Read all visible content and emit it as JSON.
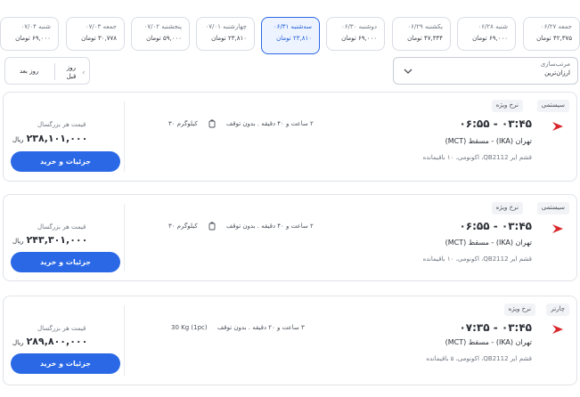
{
  "days": [
    {
      "day": "جمعه ۰۶/۲۷",
      "price": "۴۲,۳۷۵ تومان",
      "active": false
    },
    {
      "day": "شنبه ۰۶/۲۸",
      "price": "۶۹,۰۰۰ تومان",
      "active": false
    },
    {
      "day": "یکشنبه ۰۶/۲۹",
      "price": "۴۷,۳۳۴ تومان",
      "active": false
    },
    {
      "day": "دوشنبه ۰۶/۳۰",
      "price": "۶۹,۰۰۰ تومان",
      "active": false
    },
    {
      "day": "سه‌شنبه ۰۶/۳۱",
      "price": "۲۳,۸۱۰ تومان",
      "active": true
    },
    {
      "day": "چهارشنبه ۰۷/۰۱",
      "price": "۲۳,۸۱۰ تومان",
      "active": false
    },
    {
      "day": "پنجشنبه ۰۷/۰۲",
      "price": "۵۹,۰۰۰ تومان",
      "active": false
    },
    {
      "day": "جمعه ۰۷/۰۳",
      "price": "۳۰,۷۷۸ تومان",
      "active": false
    },
    {
      "day": "شنبه ۰۷/۰۴",
      "price": "۶۹,۰۰۰ تومان",
      "active": false
    }
  ],
  "sort": {
    "label": "مرتب‌سازی",
    "value": "ارزان‌ترین"
  },
  "nav": {
    "prev": "روز قبل",
    "next": "روز بعد"
  },
  "flights": [
    {
      "tags": [
        "سیستمی",
        "نرخ ویژه"
      ],
      "times": "۰۳:۴۵ - ۰۶:۵۵",
      "route": "تهران (IKA) - مسقط (MCT)",
      "info": "قشم ایر QB2112، اکونومی، ۱۰ باقیمانده",
      "duration": "۲ ساعت و ۴۰ دقیقه . بدون توقف",
      "baggage": "۳۰ کیلوگرم",
      "price_label": "قیمت هر بزرگسال",
      "price": "۲۳۸,۱۰۱,۰۰۰",
      "currency": "ریال",
      "buy": "جزئیات و خرید"
    },
    {
      "tags": [
        "سیستمی",
        "نرخ ویژه"
      ],
      "times": "۰۳:۴۵ - ۰۶:۵۵",
      "route": "تهران (IKA) - مسقط (MCT)",
      "info": "قشم ایر QB2112، اکونومی، ۱۰ باقیمانده",
      "duration": "۲ ساعت و ۴۰ دقیقه . بدون توقف",
      "baggage": "۳۰ کیلوگرم",
      "price_label": "قیمت هر بزرگسال",
      "price": "۲۴۳,۳۰۱,۰۰۰",
      "currency": "ریال",
      "buy": "جزئیات و خرید"
    },
    {
      "tags": [
        "چارتر",
        "نرخ ویژه"
      ],
      "times": "۰۳:۴۵ - ۰۷:۳۵",
      "route": "تهران (IKA) - مسقط (MCT)",
      "info": "قشم ایر QB2112، اکونومی، ۵ باقیمانده",
      "duration": "۳ ساعت و ۲۰ دقیقه . بدون توقف",
      "baggage": "30 Kg (1pc)",
      "price_label": "قیمت هر بزرگسال",
      "price": "۲۸۹,۸۰۰,۰۰۰",
      "currency": "ریال",
      "buy": "جزئیات و خرید"
    }
  ],
  "colors": {
    "accent": "#2a68e6",
    "airline_logo": "#d9262c"
  }
}
